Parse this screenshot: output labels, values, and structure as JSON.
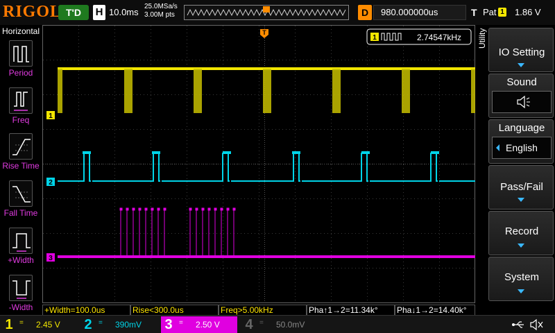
{
  "top": {
    "logo": "RIGOL",
    "trigger_status": "T'D",
    "horizontal_label": "H",
    "timebase": "10.0ms",
    "sample_rate": "25.0MSa/s",
    "memory_depth": "3.00M pts",
    "delay_label": "D",
    "delay_value": "980.000000us",
    "trigger_label": "T",
    "trigger_type": "Pat",
    "trigger_source": "1",
    "trigger_level": "1.86 V"
  },
  "left_panel": {
    "title": "Horizontal",
    "items": [
      {
        "label": "Period",
        "icon": "period-icon"
      },
      {
        "label": "Freq",
        "icon": "freq-icon"
      },
      {
        "label": "Rise Time",
        "icon": "rise-time-icon"
      },
      {
        "label": "Fall Time",
        "icon": "fall-time-icon"
      },
      {
        "label": "+Width",
        "icon": "positive-width-icon"
      },
      {
        "label": "-Width",
        "icon": "negative-width-icon"
      }
    ]
  },
  "grid": {
    "trigger_marker": "T",
    "freq_counter": {
      "channel": "1",
      "value": "2.74547kHz"
    },
    "channel_markers": [
      "1",
      "2",
      "3"
    ]
  },
  "right_menu": {
    "utility_label": "Utility",
    "io_setting": "IO Setting",
    "sound": "Sound",
    "sound_icon": "speaker-icon",
    "language": "Language",
    "language_value": "English",
    "pass_fail": "Pass/Fail",
    "record": "Record",
    "system": "System"
  },
  "measurements": [
    "+Width=100.0us",
    "Rise<300.0us",
    "Freq>5.00kHz",
    "Pha↑1→2=11.34k°",
    "Pha↓1→2=14.40k°"
  ],
  "channels": [
    {
      "num": "1",
      "coupling": "=",
      "scale": "2.45 V",
      "color": "#f2e600"
    },
    {
      "num": "2",
      "coupling": "=",
      "scale": "390mV",
      "color": "#00d4e8"
    },
    {
      "num": "3",
      "coupling": "=",
      "scale": "2.50 V",
      "color": "#e000e0"
    },
    {
      "num": "4",
      "coupling": "=",
      "scale": "50.0mV",
      "color": "#666666"
    }
  ],
  "colors": {
    "ch1": "#f2e600",
    "ch2": "#00d4e8",
    "ch3": "#e000e0",
    "accent": "#ff8c00"
  }
}
